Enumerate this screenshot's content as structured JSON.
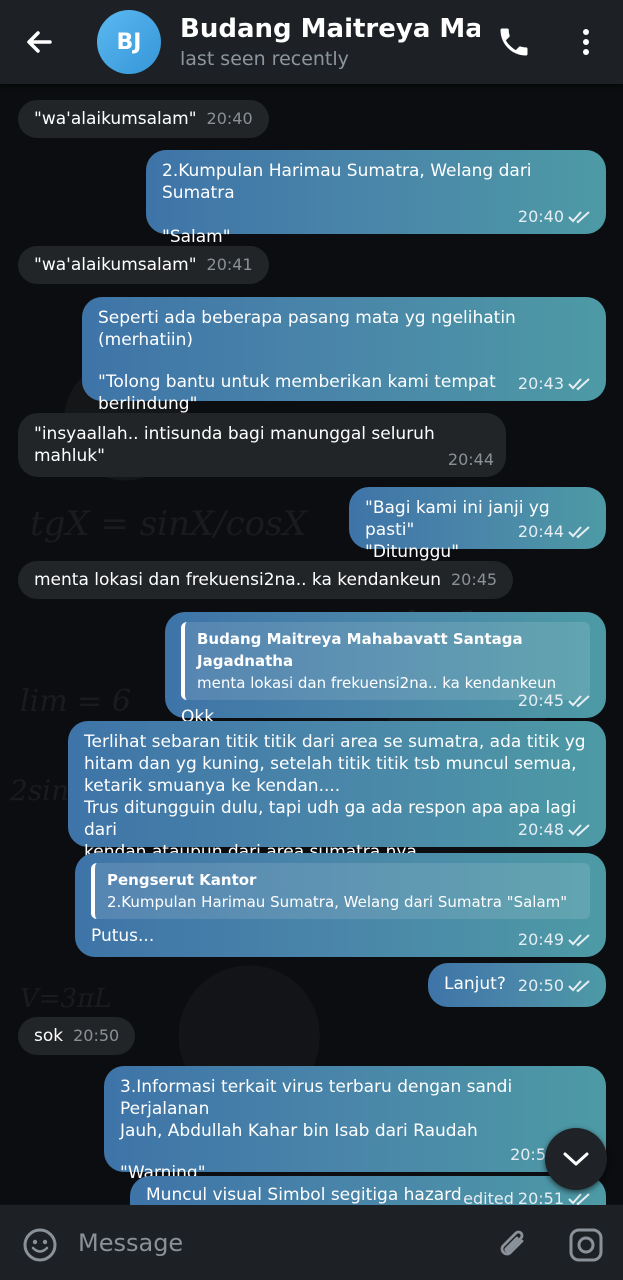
{
  "header": {
    "avatar_initials": "BJ",
    "title": "Budang Maitreya Mahab",
    "subtitle": "last seen recently"
  },
  "messages": [
    {
      "dir": "in",
      "text": "\"wa'alaikumsalam\"",
      "time": "20:40"
    },
    {
      "dir": "out",
      "line1": "2.Kumpulan Harimau Sumatra, Welang dari Sumatra",
      "line2": "\"Salam\"",
      "time": "20:40"
    },
    {
      "dir": "in",
      "text": "\"wa'alaikumsalam\"",
      "time": "20:41"
    },
    {
      "dir": "out",
      "line1": "Seperti ada beberapa pasang mata yg ngelihatin (merhatiin)",
      "line2": "\"Tolong bantu untuk memberikan kami tempat berlindung\"",
      "time": "20:43"
    },
    {
      "dir": "in",
      "text": "\"insyaallah.. intisunda bagi manunggal seluruh mahluk\"",
      "time": "20:44"
    },
    {
      "dir": "out",
      "line1": "\"Bagi kami ini janji yg pasti\"",
      "line2": "\"Ditunggu\"",
      "time": "20:44"
    },
    {
      "dir": "in",
      "text": "menta lokasi dan frekuensi2na.. ka kendankeun",
      "time": "20:45"
    },
    {
      "dir": "out",
      "reply_name": "Budang Maitreya Mahabavatt Santaga Jagadnatha",
      "reply_text": "menta lokasi dan frekuensi2na.. ka kendankeun",
      "text": "Okk",
      "time": "20:45"
    },
    {
      "dir": "out",
      "line1": "Terlihat sebaran titik titik dari area se sumatra, ada titik yg",
      "line2": "hitam dan yg kuning, setelah titik titik tsb muncul semua,",
      "line3": "ketarik smuanya ke kendan....",
      "line4": "Trus ditungguin dulu, tapi udh ga ada respon apa apa lagi dari",
      "line5": "kendan ataupun dari area sumatra nya",
      "time": "20:48"
    },
    {
      "dir": "out",
      "reply_name": "Pengserut Kantor",
      "reply_text": "2.Kumpulan Harimau Sumatra, Welang dari Sumatra  \"Salam\"",
      "text": "Putus...",
      "time": "20:49"
    },
    {
      "dir": "out",
      "text": "Lanjut?",
      "time": "20:50"
    },
    {
      "dir": "in",
      "text": "sok",
      "time": "20:50"
    },
    {
      "dir": "out",
      "line1": "3.Informasi terkait virus terbaru dengan sandi Perjalanan",
      "line2": "Jauh, Abdullah Kahar bin Isab dari Raudah",
      "line3": "\"Warning\"",
      "time": "20:5"
    },
    {
      "dir": "out",
      "text": "Muncul visual Simbol segitiga hazard",
      "edited": "edited",
      "time": "20:51"
    }
  ],
  "input": {
    "placeholder": "Message"
  },
  "icons": [
    "back-arrow-icon",
    "phone-icon",
    "more-vert-icon",
    "emoji-icon",
    "attach-icon",
    "camera-icon",
    "chevron-down-icon",
    "double-check-icon"
  ]
}
